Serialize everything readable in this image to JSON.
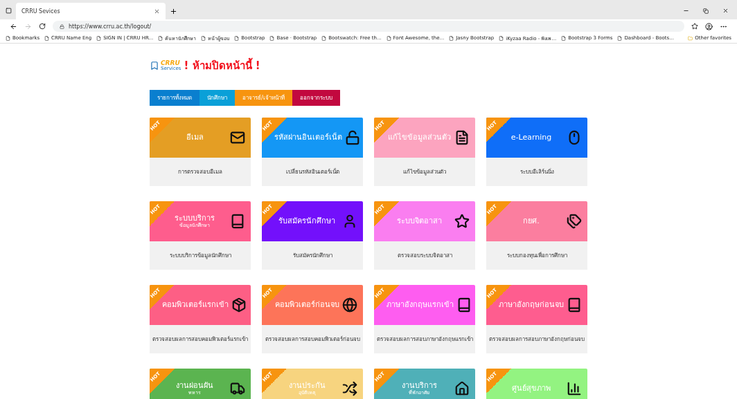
{
  "browser": {
    "tab_title": "CRRU Sevices",
    "url": "https://www.crru.ac.th/logout/",
    "bookmarks": [
      "Bookmarks",
      "CRRU Name Eng",
      "SIGN IN | CRRU HR...",
      "ค้นหานักศึกษา",
      "หน้าผู้ขอบ",
      "Bootstrap",
      "Base · Bootstrap",
      "Bootswatch: Free th...",
      "Font Awesome, the...",
      "Jasny Bootstrap",
      "iKyzaa Radio - ฟังเพ...",
      "Bootstrap 3 Forms",
      "Dashboard - Boots..."
    ],
    "other_favorites": "Other favorites"
  },
  "logo": {
    "line1": "CRRU",
    "line2": "Services"
  },
  "heading": "! ห้ามปิดหน้านี้ !",
  "nav": [
    {
      "label": "รายการทั้งหมด",
      "color": "#0a7fcf"
    },
    {
      "label": "นักศึกษา",
      "color": "#0aa0d8"
    },
    {
      "label": "อาจารย์/เจ้าหน้าที่",
      "color": "#f7940f"
    },
    {
      "label": "ออกจากระบบ",
      "color": "#c2083f"
    }
  ],
  "cards": [
    {
      "badge": "HOT",
      "title": "อีเมล",
      "description": "การตรวจสอบอีเมล",
      "color": "#e49e24"
    },
    {
      "badge": "HOT",
      "title": "รหัสผ่านอินเตอร์เน็ต",
      "description": "เปลี่ยนรหัสอินเตอร์เน็ต",
      "color": "#1497f5"
    },
    {
      "badge": "HOT",
      "title": "แก้ไขข้อมูลส่วนตัว",
      "description": "แก้ไขข้อมูลส่วนตัว",
      "color": "#fca4bf"
    },
    {
      "badge": "HOT",
      "title": "e-Learning",
      "description": "ระบบอีเลิร์นนิ่ง",
      "color": "#0f6ef8"
    },
    {
      "badge": "HOT",
      "title": "ระบบบริการ",
      "subtitle": "ข้อมูลนักศึกษา",
      "description": "ระบบบริการข้อมูลนักศึกษา",
      "color": "#fe5d8d"
    },
    {
      "badge": "HOT",
      "title": "รับสมัครนักศึกษา",
      "description": "รับสมัครนักศึกษา",
      "color": "#7310fb"
    },
    {
      "badge": "HOT",
      "title": "ระบบจิตอาสา",
      "description": "ตรวจสอบระบบจิตอาสา",
      "color": "#fa7ef0"
    },
    {
      "badge": "HOT",
      "title": "กยศ.",
      "description": "ระบบกองทุนเพื่อการศึกษา",
      "color": "#fb7e9f"
    },
    {
      "badge": "HOT",
      "title": "คอมพิวเตอร์แรกเข้า",
      "description": "ตรวจสอบผลการสอบคอมพิวเตอร์แรกเข้า",
      "color": "#fd5f85"
    },
    {
      "badge": "HOT",
      "title": "คอมพิวเตอร์ก่อนจบ",
      "description": "ตรวจสอบผลการสอบคอมพิวเตอร์ก่อนจบ",
      "color": "#fd7459"
    },
    {
      "badge": "HOT",
      "title": "ภาษาอังกฤษแรกเข้า",
      "description": "ตรวจสอบผลการสอบภาษาอังกฤษแรกเข้า",
      "color": "#fe5df0"
    },
    {
      "badge": "HOT",
      "title": "ภาษาอังกฤษก่อนจบ",
      "description": "ตรวจสอบผลการสอบภาษาอังกฤษก่อนจบ",
      "color": "#fe5d8f"
    },
    {
      "badge": "HOT",
      "title": "งานผ่อนผัน",
      "subtitle": "ทหาร",
      "color": "#5bb450"
    },
    {
      "badge": "HOT",
      "title": "งานประกัน",
      "subtitle": "อุบัติเหตุ",
      "color": "#f7d47f"
    },
    {
      "badge": "HOT",
      "title": "งานบริการ",
      "subtitle": "ที่พักอาศัย",
      "color": "#4fb0b8"
    },
    {
      "badge": "HOT",
      "title": "ศูนย์สุขภาพ",
      "color": "#93f381"
    }
  ]
}
